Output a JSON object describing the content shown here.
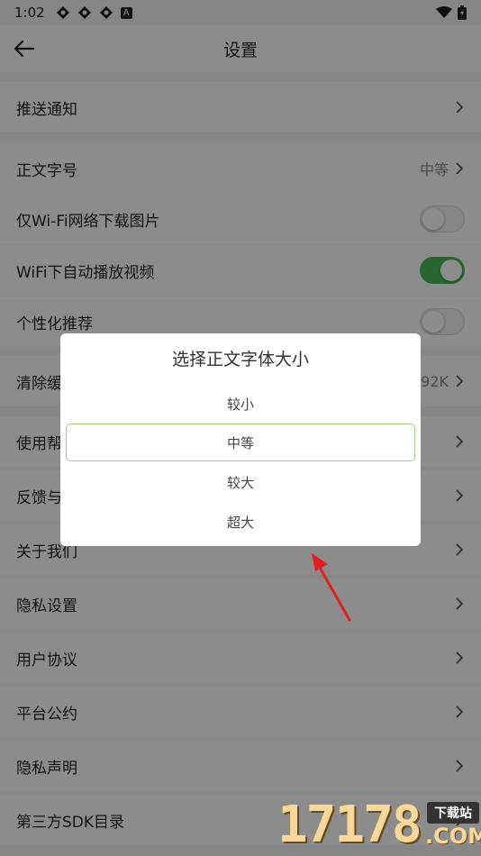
{
  "status_bar": {
    "time": "1:02",
    "notif_letter": "A"
  },
  "toolbar": {
    "title": "设置",
    "back_icon": "arrow-left-icon"
  },
  "rows": [
    {
      "label": "推送通知",
      "type": "chevron"
    },
    {
      "label": "正文字号",
      "type": "value",
      "value": "中等"
    },
    {
      "label": "仅Wi-Fi网络下载图片",
      "type": "switch",
      "on": false
    },
    {
      "label": "WiFi下自动播放视频",
      "type": "switch",
      "on": true
    },
    {
      "label": "个性化推荐",
      "type": "switch",
      "on": false
    },
    {
      "label": "清除缓",
      "type": "value",
      "value": "92K"
    },
    {
      "label": "使用帮",
      "type": "chevron"
    },
    {
      "label": "反馈与",
      "type": "chevron"
    },
    {
      "label": "关于我们",
      "type": "chevron"
    },
    {
      "label": "隐私设置",
      "type": "chevron"
    },
    {
      "label": "用户协议",
      "type": "chevron"
    },
    {
      "label": "平台公约",
      "type": "chevron"
    },
    {
      "label": "隐私声明",
      "type": "chevron"
    },
    {
      "label": "第三方SDK目录",
      "type": "chevron"
    }
  ],
  "dialog": {
    "title": "选择正文字体大小",
    "options": [
      "较小",
      "中等",
      "较大",
      "超大"
    ],
    "selected": "中等"
  },
  "colors": {
    "accent": "#4cba5a",
    "selected_border": "#9fd27c",
    "annotation_arrow": "#e02020"
  },
  "watermark": {
    "digits": "17178",
    "badge": "下载站",
    "domain": ".COM"
  }
}
